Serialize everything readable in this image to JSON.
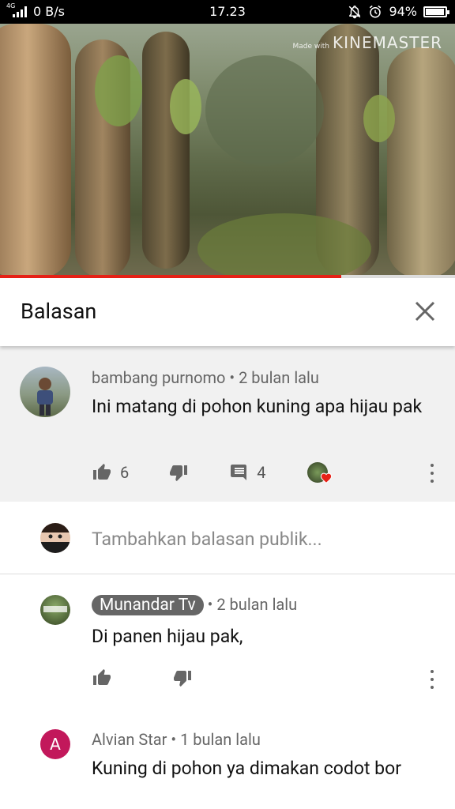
{
  "status_bar": {
    "network": "4G",
    "data_speed": "0 B/s",
    "time": "17.23",
    "battery": "94%"
  },
  "video": {
    "watermark_prefix": "Made with",
    "watermark": "KINEMASTER",
    "progress_percent": 75
  },
  "header": {
    "title": "Balasan"
  },
  "parent_comment": {
    "author": "bambang purnomo",
    "time": "2 bulan lalu",
    "text": "Ini matang di pohon kuning apa hijau pak",
    "likes": "6",
    "reply_count": "4"
  },
  "reply_input": {
    "placeholder": "Tambahkan balasan publik..."
  },
  "replies": [
    {
      "author": "Munandar Tv",
      "time": "2 bulan lalu",
      "text": "Di panen hijau pak,"
    },
    {
      "author": "Alvian Star",
      "avatar_letter": "A",
      "time": "1 bulan lalu",
      "text": "Kuning di pohon ya dimakan codot bor"
    }
  ]
}
